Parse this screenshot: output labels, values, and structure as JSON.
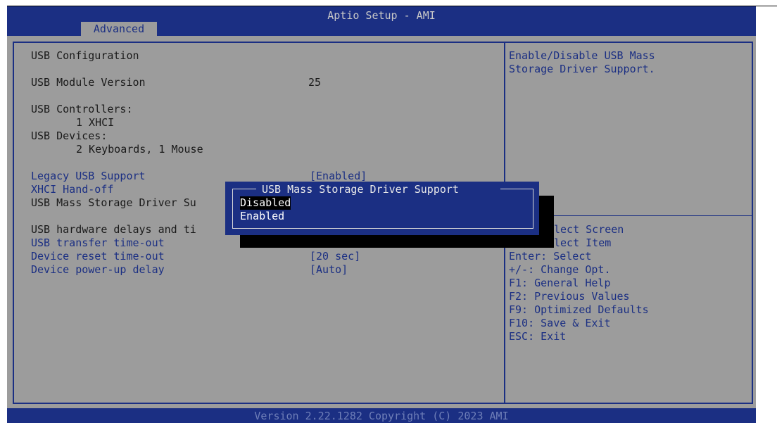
{
  "window": {
    "title": "Aptio Setup - AMI",
    "tab": "Advanced",
    "footer": "Version 2.22.1282 Copyright (C) 2023 AMI"
  },
  "main": {
    "usb_configuration": "USB Configuration",
    "module_version_label": "USB Module Version",
    "module_version_value": "25",
    "controllers_label": "USB Controllers:",
    "controllers_value": "1 XHCI",
    "devices_label": "USB Devices:",
    "devices_value": "2 Keyboards, 1 Mouse",
    "legacy_usb_label": "Legacy USB Support",
    "legacy_usb_value": "[Enabled]",
    "xhci_handoff_label": "XHCI Hand-off",
    "mass_storage_label": "USB Mass Storage Driver Su",
    "hw_delays_label": "USB hardware delays and ti",
    "transfer_timeout_label": "USB transfer time-out",
    "reset_timeout_label": "Device reset time-out",
    "reset_timeout_value": "[20 sec]",
    "powerup_delay_label": "Device power-up delay",
    "powerup_delay_value": "[Auto]"
  },
  "help": {
    "description_line1": "Enable/Disable USB Mass",
    "description_line2": "Storage Driver Support.",
    "keys": [
      "lect Screen",
      "lect Item",
      "Enter: Select",
      "+/-: Change Opt.",
      "F1: General Help",
      "F2: Previous Values",
      "F9: Optimized Defaults",
      "F10: Save & Exit",
      "ESC: Exit"
    ]
  },
  "popup": {
    "title": "USB Mass Storage Driver Support",
    "options": [
      "Disabled",
      "Enabled"
    ],
    "selected": "Disabled"
  },
  "colors": {
    "bios_blue": "#1b2f83",
    "panel_gray": "#9c9c9c",
    "selection_black": "#000000"
  }
}
